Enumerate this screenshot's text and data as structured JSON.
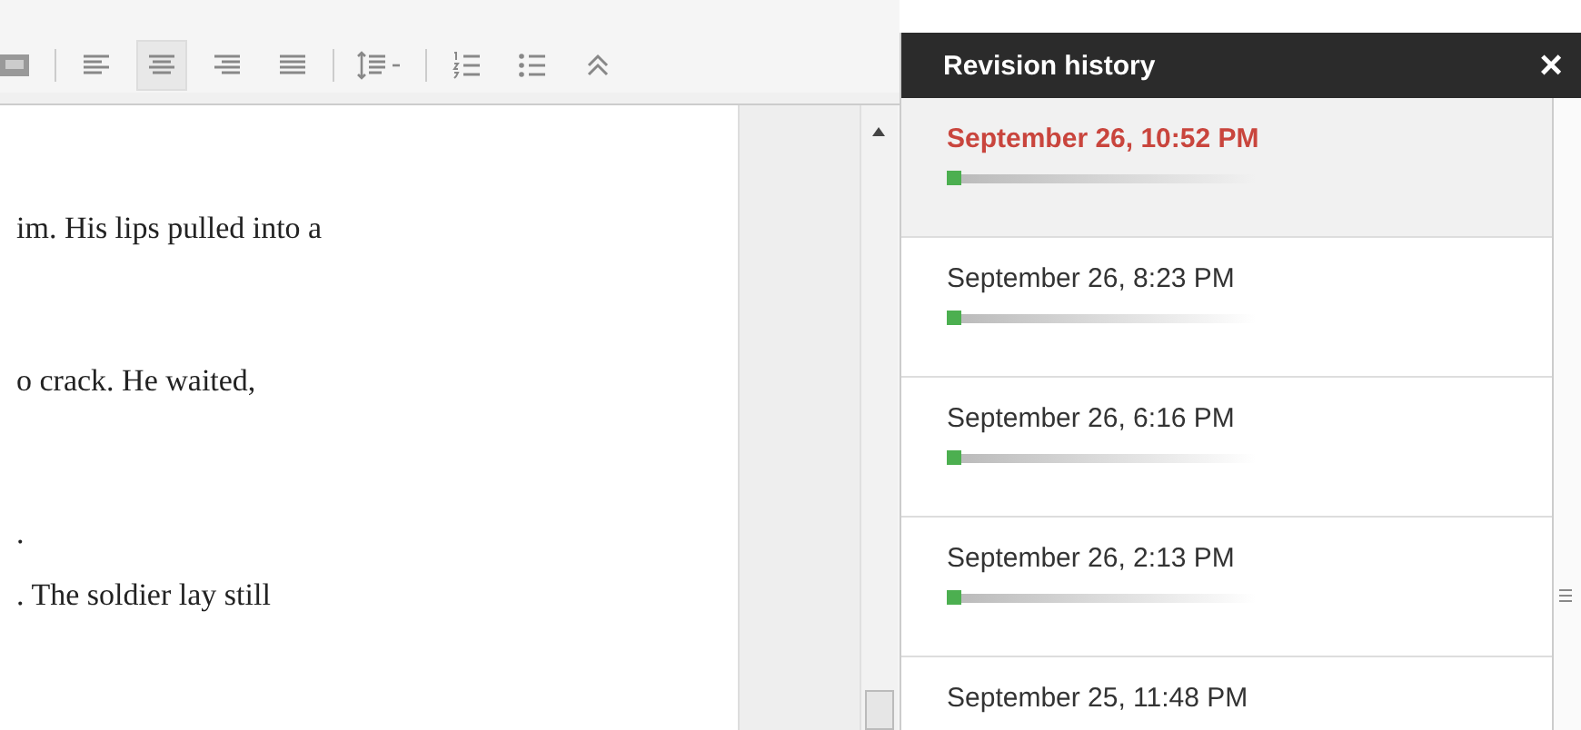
{
  "toolbar": {
    "buttons": [
      {
        "kind": "image",
        "selected": false
      },
      {
        "kind": "align-left",
        "selected": false
      },
      {
        "kind": "align-center",
        "selected": true
      },
      {
        "kind": "align-right",
        "selected": false
      },
      {
        "kind": "justify",
        "selected": false
      },
      {
        "kind": "line-spacing",
        "selected": false
      },
      {
        "kind": "numbered-list",
        "selected": false
      },
      {
        "kind": "bulleted-list",
        "selected": false
      },
      {
        "kind": "collapse",
        "selected": false
      }
    ]
  },
  "document": {
    "paragraphs": [
      "im. His lips pulled into a",
      "o crack. He waited,",
      ".",
      ". The soldier lay still"
    ]
  },
  "revision_history": {
    "title": "Revision history",
    "close": "×",
    "revisions": [
      {
        "time": "September 26, 10:52 PM",
        "selected": true
      },
      {
        "time": "September 26, 8:23 PM",
        "selected": false
      },
      {
        "time": "September 26, 6:16 PM",
        "selected": false
      },
      {
        "time": "September 26, 2:13 PM",
        "selected": false
      },
      {
        "time": "September 25, 11:48 PM",
        "selected": false
      }
    ]
  }
}
